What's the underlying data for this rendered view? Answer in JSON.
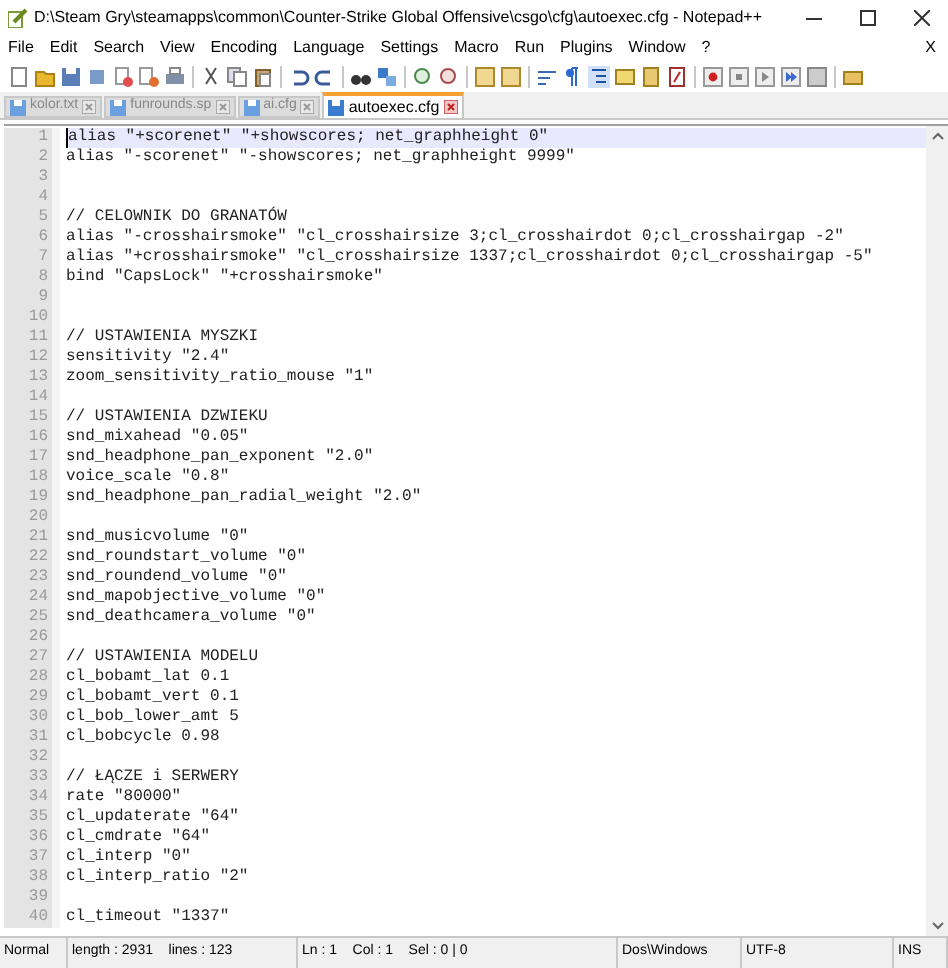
{
  "window": {
    "title": "D:\\Steam Gry\\steamapps\\common\\Counter-Strike Global Offensive\\csgo\\cfg\\autoexec.cfg - Notepad++"
  },
  "menu": [
    "File",
    "Edit",
    "Search",
    "View",
    "Encoding",
    "Language",
    "Settings",
    "Macro",
    "Run",
    "Plugins",
    "Window",
    "?"
  ],
  "menu_close": "X",
  "tabs": [
    {
      "label": "kolor.txt",
      "selected": false
    },
    {
      "label": "funrounds.sp",
      "selected": false
    },
    {
      "label": "ai.cfg",
      "selected": false
    },
    {
      "label": "autoexec.cfg",
      "selected": true
    }
  ],
  "editor": {
    "lines": [
      {
        "number": "1",
        "text": "alias \"+scorenet\" \"+showscores; net_graphheight 0\"",
        "current": true
      },
      {
        "number": "2",
        "text": "alias \"-scorenet\" \"-showscores; net_graphheight 9999\"",
        "current": false
      },
      {
        "number": "3",
        "current": false
      },
      {
        "number": "4",
        "current": false
      },
      {
        "number": "5",
        "text": "// CELOWNIK DO GRANATÓW",
        "current": false
      },
      {
        "number": "6",
        "text": "alias \"-crosshairsmoke\" \"cl_crosshairsize 3;cl_crosshairdot 0;cl_crosshairgap -2\"",
        "current": false
      },
      {
        "number": "7",
        "text": "alias \"+crosshairsmoke\" \"cl_crosshairsize 1337;cl_crosshairdot 0;cl_crosshairgap -5\"",
        "current": false
      },
      {
        "number": "8",
        "text": "bind \"CapsLock\" \"+crosshairsmoke\"",
        "current": false
      },
      {
        "number": "9",
        "current": false
      },
      {
        "number": "10",
        "current": false
      },
      {
        "number": "11",
        "text": "// USTAWIENIA MYSZKI",
        "current": false
      },
      {
        "number": "12",
        "text": "sensitivity \"2.4\"",
        "current": false
      },
      {
        "number": "13",
        "text": "zoom_sensitivity_ratio_mouse \"1\"",
        "current": false
      },
      {
        "number": "14",
        "current": false
      },
      {
        "number": "15",
        "text": "// USTAWIENIA DZWIEKU",
        "current": false
      },
      {
        "number": "16",
        "text": "snd_mixahead \"0.05\"",
        "current": false
      },
      {
        "number": "17",
        "text": "snd_headphone_pan_exponent \"2.0\"",
        "current": false
      },
      {
        "number": "18",
        "text": "voice_scale \"0.8\"",
        "current": false
      },
      {
        "number": "19",
        "text": "snd_headphone_pan_radial_weight \"2.0\"",
        "current": false
      },
      {
        "number": "20",
        "current": false
      },
      {
        "number": "21",
        "text": "snd_musicvolume \"0\"",
        "current": false
      },
      {
        "number": "22",
        "text": "snd_roundstart_volume \"0\"",
        "current": false
      },
      {
        "number": "23",
        "text": "snd_roundend_volume \"0\"",
        "current": false
      },
      {
        "number": "24",
        "text": "snd_mapobjective_volume \"0\"",
        "current": false
      },
      {
        "number": "25",
        "text": "snd_deathcamera_volume \"0\"",
        "current": false
      },
      {
        "number": "26",
        "current": false
      },
      {
        "number": "27",
        "text": "// USTAWIENIA MODELU",
        "current": false
      },
      {
        "number": "28",
        "text": "cl_bobamt_lat 0.1",
        "current": false
      },
      {
        "number": "29",
        "text": "cl_bobamt_vert 0.1",
        "current": false
      },
      {
        "number": "30",
        "text": "cl_bob_lower_amt 5",
        "current": false
      },
      {
        "number": "31",
        "text": "cl_bobcycle 0.98",
        "current": false
      },
      {
        "number": "32",
        "current": false
      },
      {
        "number": "33",
        "text": "// ŁĄCZE i SERWERY",
        "current": false
      },
      {
        "number": "34",
        "text": "rate \"80000\"",
        "current": false
      },
      {
        "number": "35",
        "text": "cl_updaterate \"64\"",
        "current": false
      },
      {
        "number": "36",
        "text": "cl_cmdrate \"64\"",
        "current": false
      },
      {
        "number": "37",
        "text": "cl_interp \"0\"",
        "current": false
      },
      {
        "number": "38",
        "text": "cl_interp_ratio \"2\"",
        "current": false
      },
      {
        "number": "39",
        "current": false
      },
      {
        "number": "40",
        "text": "cl_timeout \"1337\"",
        "current": false
      }
    ]
  },
  "status_bar": [
    "Normal",
    "length : 2931    lines : 123",
    "Ln : 1    Col : 1    Sel : 0 | 0",
    "Dos\\Windows",
    "UTF-8",
    "INS"
  ]
}
